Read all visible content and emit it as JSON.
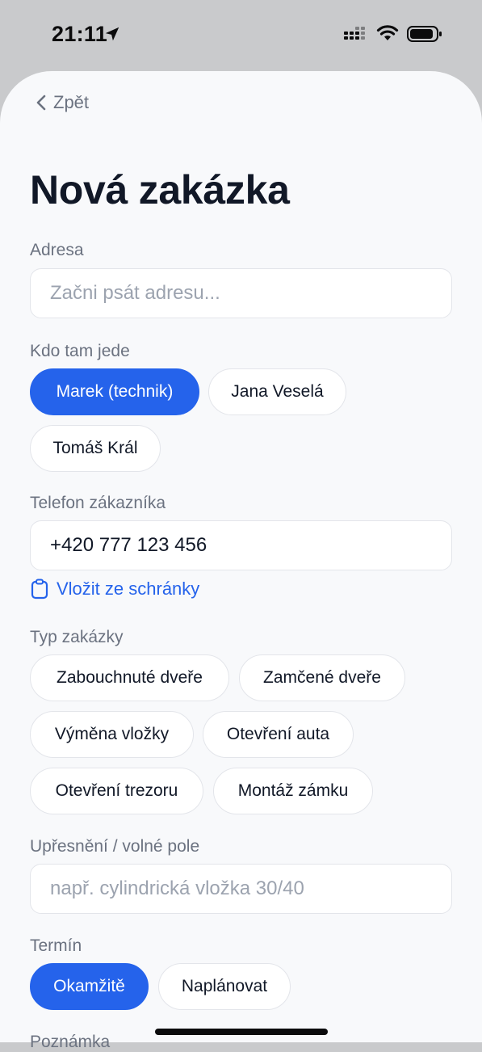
{
  "status_bar": {
    "time": "21:11"
  },
  "nav": {
    "back_label": "Zpět"
  },
  "page_title": "Nová zakázka",
  "address": {
    "label": "Adresa",
    "placeholder": "Začni psát adresu..."
  },
  "assignee": {
    "label": "Kdo tam jede",
    "options": [
      "Marek (technik)",
      "Jana Veselá",
      "Tomáš Král"
    ],
    "selected": "Marek (technik)"
  },
  "phone": {
    "label": "Telefon zákazníka",
    "value": "+420 777 123 456",
    "paste_label": "Vložit ze schránky"
  },
  "job_type": {
    "label": "Typ zakázky",
    "options": [
      "Zabouchnuté dveře",
      "Zamčené dveře",
      "Výměna vložky",
      "Otevření auta",
      "Otevření trezoru",
      "Montáž zámku"
    ]
  },
  "details": {
    "label": "Upřesnění / volné pole",
    "placeholder": "např. cylindrická vložka 30/40"
  },
  "term": {
    "label": "Termín",
    "options": [
      "Okamžitě",
      "Naplánovat"
    ],
    "selected": "Okamžitě"
  },
  "note": {
    "label": "Poznámka"
  },
  "colors": {
    "accent": "#2563eb",
    "text": "#111827",
    "muted": "#6b7280",
    "background": "#f8f9fb"
  }
}
